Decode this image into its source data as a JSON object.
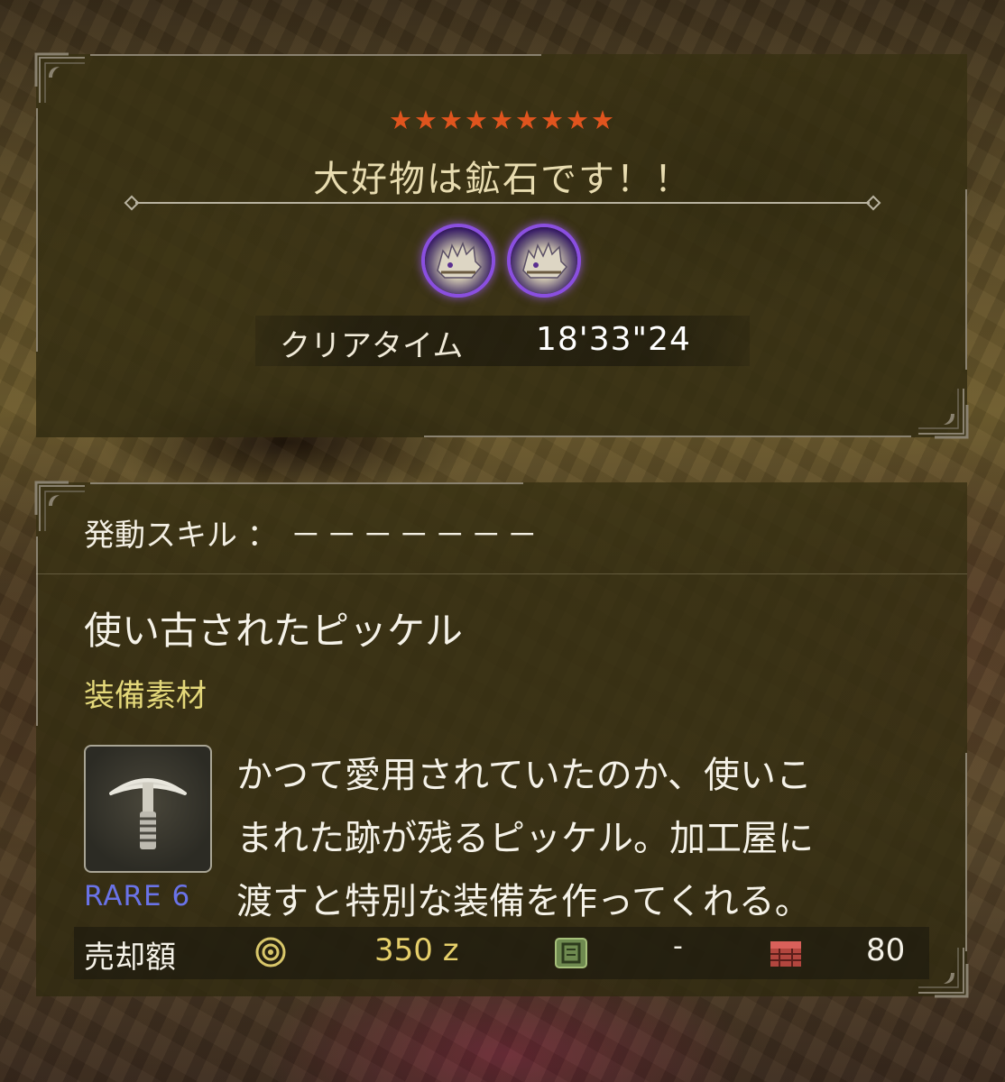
{
  "quest": {
    "stars": "★★★★★★★★★",
    "title": "大好物は鉱石です！！",
    "clear_label": "クリアタイム",
    "clear_time": "18'33\"24"
  },
  "monster_icons": [
    "monster-icon",
    "monster-icon"
  ],
  "skill": {
    "label": "発動スキル ：",
    "value": "－－－－－－－"
  },
  "item": {
    "name": "使い古されたピッケル",
    "category": "装備素材",
    "icon": "pickaxe-icon",
    "rarity": "RARE 6",
    "description": [
      "かつて愛用されていたのか、使いこ",
      "まれた跡が残るピッケル。加工屋に",
      "渡すと特別な装備を作ってくれる。"
    ]
  },
  "price": {
    "label": "売却額",
    "zenny": "350 z",
    "points": "-",
    "box": "80"
  },
  "colors": {
    "star": "#e0541e",
    "title": "#e8dcb0",
    "category": "#e4d87a",
    "rarity": "#6a73e8",
    "zenny": "#e6cf6a",
    "monster_glow": "#8a4fe0"
  }
}
